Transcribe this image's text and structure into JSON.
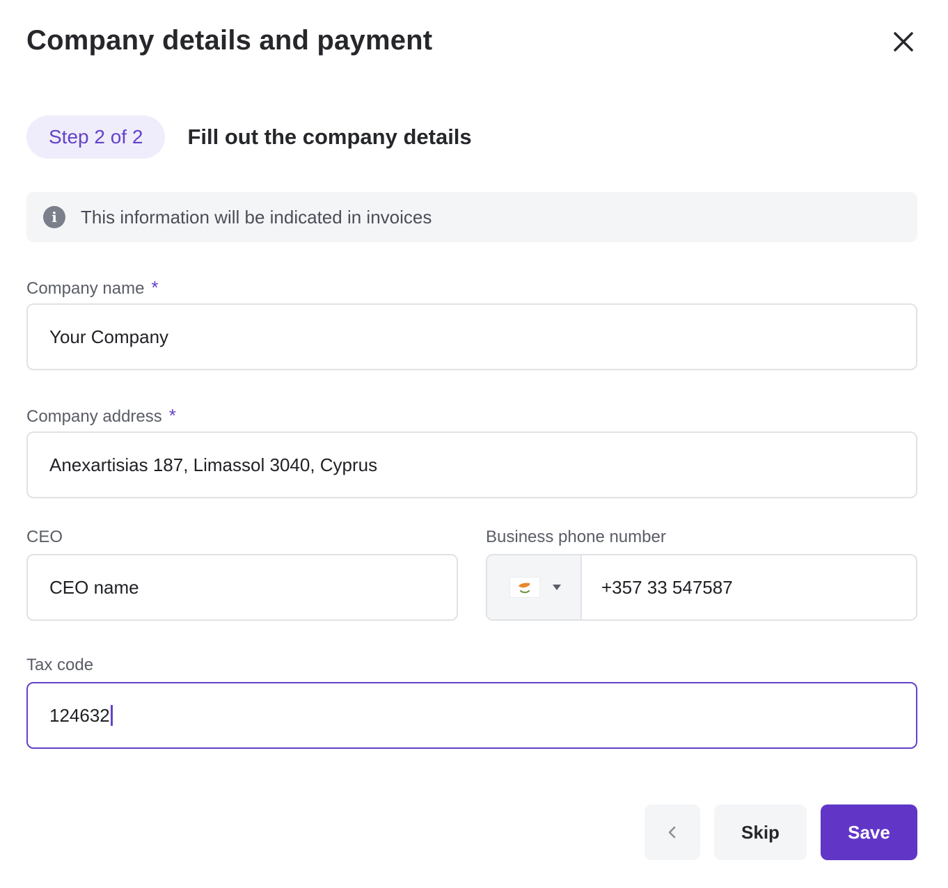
{
  "dialog": {
    "title": "Company details and payment"
  },
  "step": {
    "indicator": "Step 2 of 2",
    "heading": "Fill out the company details"
  },
  "info": {
    "text": "This information will be indicated in invoices",
    "icon": "info-icon"
  },
  "form": {
    "required_mark": "*",
    "company_name": {
      "label": "Company name",
      "value": "Your Company",
      "required": true
    },
    "company_address": {
      "label": "Company address",
      "value": "Anexartisias 187, Limassol 3040, Cyprus",
      "required": true
    },
    "ceo": {
      "label": "CEO",
      "placeholder": "CEO name"
    },
    "phone": {
      "label": "Business phone number",
      "country_flag": "cyprus-flag-icon",
      "value": "+357 33 547587"
    },
    "tax_code": {
      "label": "Tax code",
      "value": "124632"
    }
  },
  "actions": {
    "back_icon": "chevron-left-icon",
    "skip_label": "Skip",
    "save_label": "Save"
  },
  "colors": {
    "accent": "#6136c7",
    "pill_bg": "#efedfb",
    "banner_bg": "#f4f5f7",
    "border": "#e1e2e6"
  }
}
